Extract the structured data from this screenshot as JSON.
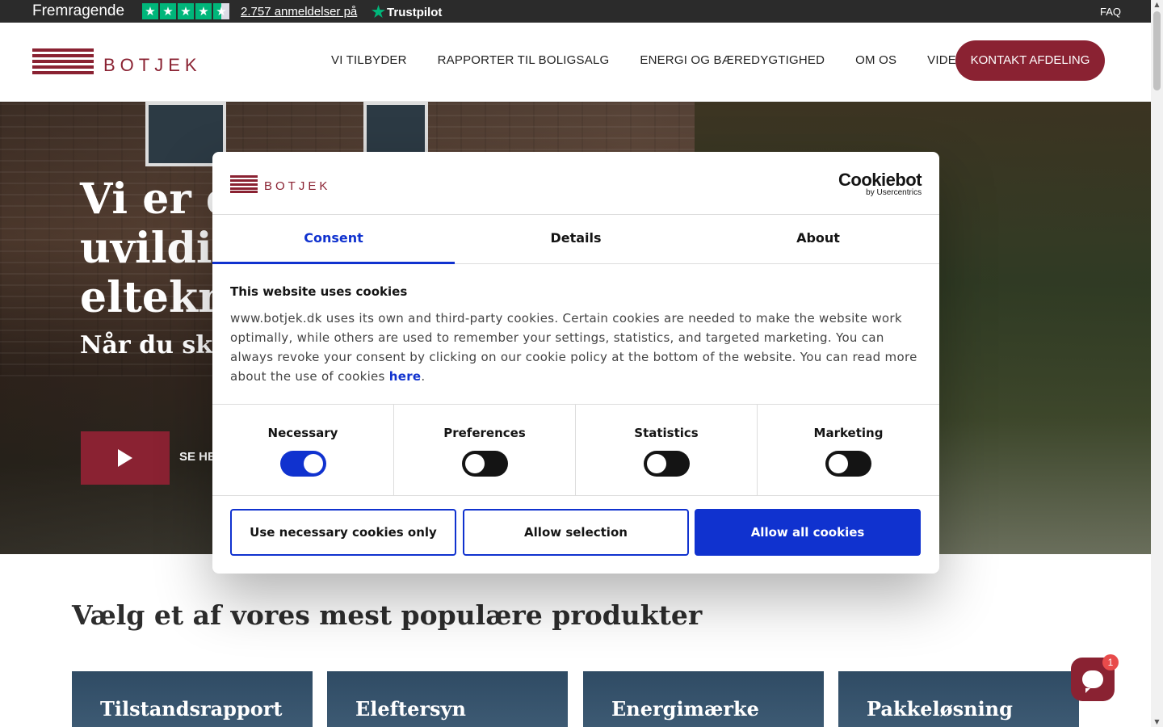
{
  "trustbar": {
    "rating": "Fremragende",
    "reviews": "2.757 anmeldelser på",
    "trustpilot": "Trustpilot",
    "faq": "FAQ"
  },
  "header": {
    "logo_text": "BOTJEK",
    "nav": [
      "VI TILBYDER",
      "RAPPORTER TIL BOLIGSALG",
      "ENERGI OG BÆREDYGTIGHED",
      "OM OS",
      "VIDEN OG RÅD"
    ],
    "cta": "KONTAKT AFDELING"
  },
  "hero": {
    "title_lines": [
      "Vi er d",
      "uvildig",
      "eltekn"
    ],
    "subtitle": "Når du ska",
    "play_label": "SE HE"
  },
  "products": {
    "title": "Vælg et af vores mest populære produkter",
    "cards": [
      "Tilstandsrapport",
      "Eleftersyn",
      "Energimærke",
      "Pakkeløsning"
    ]
  },
  "chat": {
    "badge": "1"
  },
  "cookie_dialog": {
    "logo_text": "BOTJEK",
    "provider": "Cookiebot",
    "provider_sub": "by Usercentrics",
    "tabs": [
      "Consent",
      "Details",
      "About"
    ],
    "active_tab": "Consent",
    "title": "This website uses cookies",
    "text": "www.botjek.dk uses its own and third-party cookies. Certain cookies are needed to make the website work optimally, while others are used to remember your settings, statistics, and targeted marketing. You can always revoke your consent by clicking on our cookie policy at the bottom of the website. You can read more about the use of cookies",
    "link": "here",
    "toggles": [
      {
        "label": "Necessary",
        "on": true
      },
      {
        "label": "Preferences",
        "on": false
      },
      {
        "label": "Statistics",
        "on": false
      },
      {
        "label": "Marketing",
        "on": false
      }
    ],
    "buttons": {
      "necessary_only": "Use necessary cookies only",
      "allow_selection": "Allow selection",
      "allow_all": "Allow all cookies"
    }
  },
  "colors": {
    "brand": "#8a2232",
    "cookiebot_blue": "#1032cf",
    "trustpilot_green": "#00b67a"
  }
}
